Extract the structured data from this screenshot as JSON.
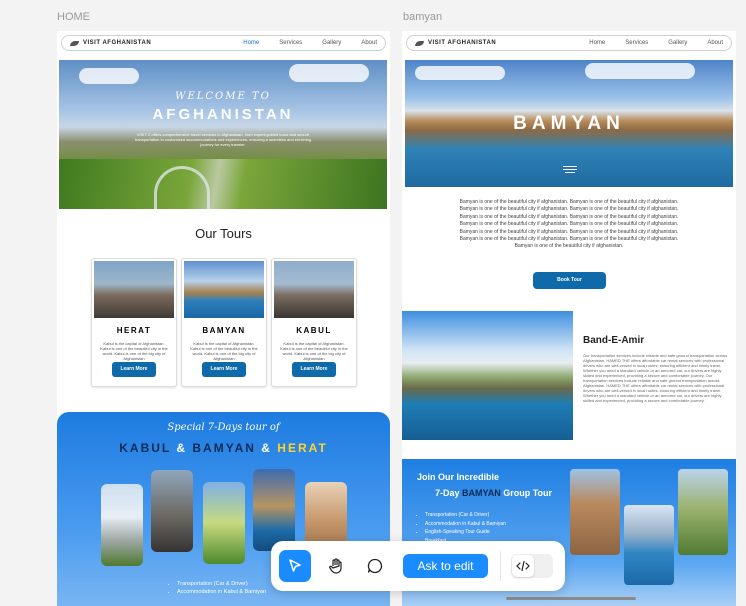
{
  "canvas": {
    "frame_labels": [
      "HOME",
      "bamyan"
    ]
  },
  "home": {
    "nav": {
      "logo": "VISIT AFGHANISTAN",
      "links": [
        "Home",
        "Services",
        "Gallery",
        "About"
      ]
    },
    "hero": {
      "subtitle": "WELCOME TO",
      "title": "AFGHANISTAN",
      "body": "VISIT Z offers comprehensive travel services in Afghanistan, from expert-guided tours and secure transportation to customized accommodations and experiences, ensuring a seamless and enriching journey for every traveler."
    },
    "tours_heading": "Our Tours",
    "cards": [
      {
        "title": "HERAT",
        "desc": "Kabul is the capital of Afghanistan. Kabul is one of the beautiful city in the world. Kabul is one of the big city of Afghanistan",
        "button": "Learn More"
      },
      {
        "title": "BAMYAN",
        "desc": "Kabul is the capital of Afghanistan. Kabul is one of the beautiful city in the world. Kabul is one of the big city of Afghanistan",
        "button": "Learn More"
      },
      {
        "title": "KABUL",
        "desc": "Kabul is the capital of Afghanistan. Kabul is one of the beautiful city in the world. Kabul is one of the big city of Afghanistan",
        "button": "Learn More"
      }
    ],
    "special": {
      "subtitle": "Special 7-Days tour of",
      "title_parts": [
        "KABUL",
        "&",
        "BAMYAN",
        "&",
        "HERAT"
      ],
      "list": [
        "Transportation (Car & Driver)",
        "Accommodation in Kabul & Bamiyan"
      ]
    }
  },
  "bamyan": {
    "nav": {
      "logo": "VISIT AFGHANISTAN",
      "links": [
        "Home",
        "Services",
        "Gallery",
        "About"
      ]
    },
    "hero_title": "BAMYAN",
    "paragraph": "Bamyan is one of the beautiful city if afghanistan. Bamyan is one of the beautiful city if afghanistan. Bamyan is one of the beautiful city if afghanistan. Bamyan is one of the beautiful city if afghanistan. Bamyan is one of the beautiful city if afghanistan. Bamyan is one of the beautiful city if afghanistan. Bamyan is one of the beautiful city if afghanistan. Bamyan is one of the beautiful city if afghanistan. Bamyan is one of the beautiful city if afghanistan. Bamyan is one of the beautiful city if afghanistan. Bamyan is one of the beautiful city if afghanistan. Bamyan is one of the beautiful city if afghanistan. Bamyan is one of the beautiful city if afghanistan.",
    "book_button": "Book Tour",
    "band": {
      "title": "Band-E-Amir",
      "text": "Our transportation services include reliable and safe ground transportation across Afghanistan. HAMED THE offers affordable car rental services with professional drivers who are well-versed in local routes, ensuring efficient and timely travel. Whether you need a standard vehicle or an armored car, our drivers are highly skilled and experienced, providing a secure and comfortable journey. Our transportation services include reliable and safe ground transportation across Afghanistan. HAMED THE offers affordable car rental services with professional drivers who are well-versed in local routes, ensuring efficient and timely travel. Whether you need a standard vehicle or an armored car, our drivers are highly skilled and experienced, providing a secure and comfortable journey."
    },
    "join": {
      "line1": "Join Our Incredible",
      "line2_pre": "7-Day",
      "line2_highlight": "BAMYAN",
      "line2_post": "Group Tour",
      "list": [
        "Transportation (Car & Driver)",
        "Accommodation in Kabul & Bamiyan",
        "English-Speaking Tour Guide",
        "Breakfast"
      ]
    }
  },
  "toolbar": {
    "select_icon": "cursor-arrow-icon",
    "hand_icon": "hand-icon",
    "comment_icon": "comment-bubble-icon",
    "ask_button": "Ask to edit",
    "code_icon": "code-icon"
  },
  "colors": {
    "accent": "#1a8cff",
    "button": "#0e6aa8",
    "special_bg": "#1f7fe0"
  }
}
